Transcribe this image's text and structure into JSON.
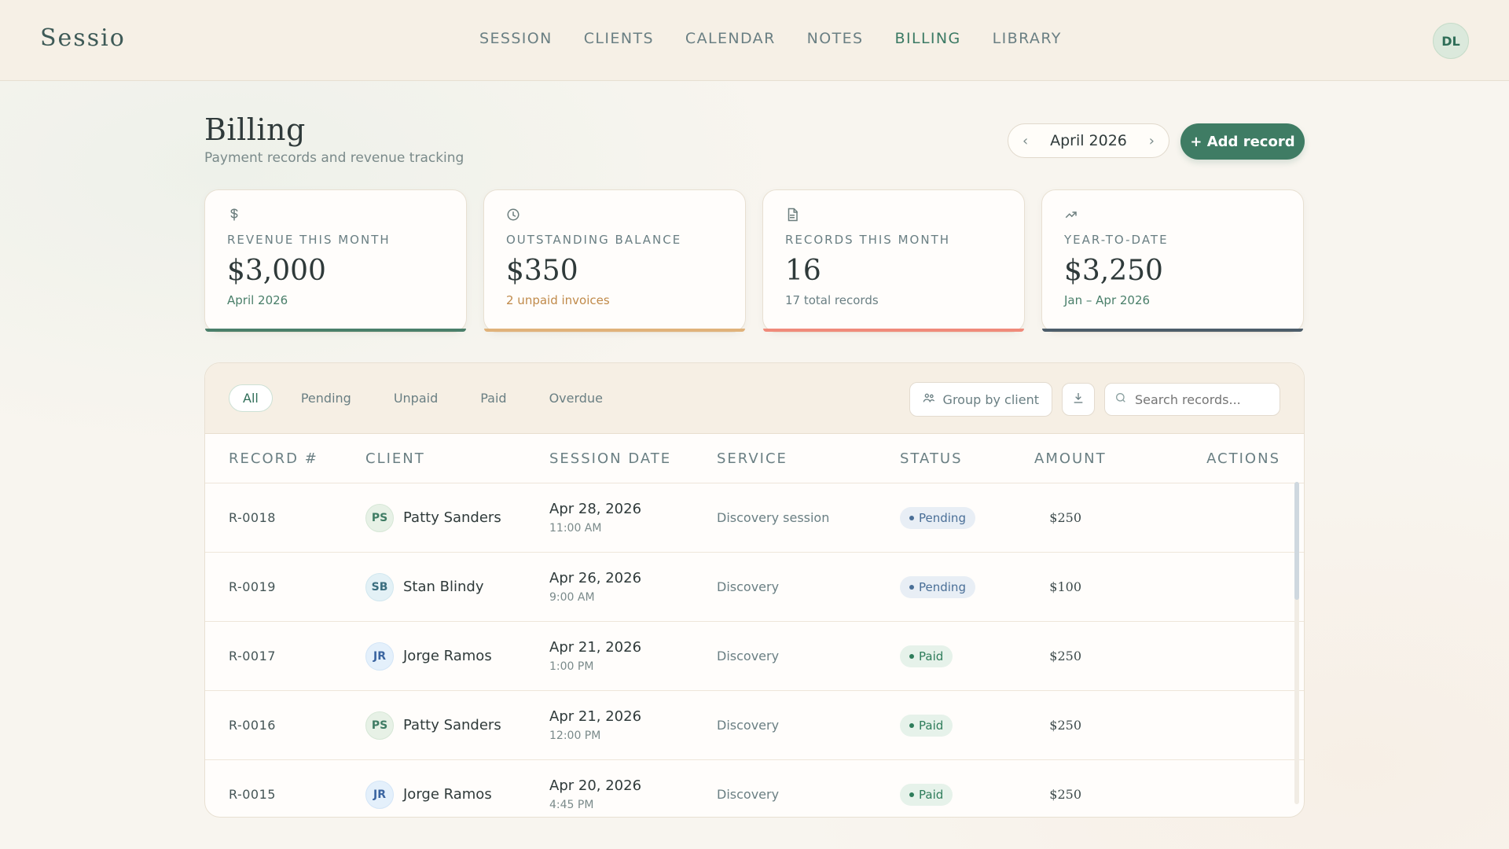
{
  "brand": "Sessio",
  "nav": {
    "items": [
      "SESSION",
      "CLIENTS",
      "CALENDAR",
      "NOTES",
      "BILLING",
      "LIBRARY"
    ],
    "active": "BILLING"
  },
  "user": {
    "initials": "DL"
  },
  "header": {
    "title": "Billing",
    "subtitle": "Payment records and revenue tracking",
    "month_label": "April 2026",
    "add_button": "+ Add record"
  },
  "stats": [
    {
      "kicker": "REVENUE THIS MONTH",
      "value": "$3,000",
      "sub": "April 2026",
      "icon": "dollar-icon",
      "sub_color": "#4a7f6a",
      "accent": "#4a7f6a"
    },
    {
      "kicker": "OUTSTANDING BALANCE",
      "value": "$350",
      "sub": "2 unpaid invoices",
      "icon": "clock-icon",
      "sub_color": "#c08a4a",
      "accent": "#e0b27a"
    },
    {
      "kicker": "RECORDS THIS MONTH",
      "value": "16",
      "sub": "17 total records",
      "icon": "document-icon",
      "sub_color": "#6a7f83",
      "accent": "#f08a7a"
    },
    {
      "kicker": "YEAR-TO-DATE",
      "value": "$3,250",
      "sub": "Jan – Apr 2026",
      "icon": "trend-icon",
      "sub_color": "#4a7f6a",
      "accent": "#4d5d6a"
    }
  ],
  "filters": [
    "All",
    "Pending",
    "Unpaid",
    "Paid",
    "Overdue"
  ],
  "toolbar": {
    "group_by": "Group by client",
    "search_placeholder": "Search records..."
  },
  "table": {
    "headers": [
      "RECORD #",
      "CLIENT",
      "SESSION DATE",
      "SERVICE",
      "STATUS",
      "AMOUNT",
      "ACTIONS"
    ],
    "rows": [
      {
        "record": "R-0018",
        "initials": "PS",
        "client": "Patty Sanders",
        "date": "Apr 28, 2026",
        "time": "11:00 AM",
        "service": "Discovery session",
        "status": "Pending",
        "amount": "$250"
      },
      {
        "record": "R-0019",
        "initials": "SB",
        "client": "Stan Blindy",
        "date": "Apr 26, 2026",
        "time": "9:00 AM",
        "service": "Discovery",
        "status": "Pending",
        "amount": "$100"
      },
      {
        "record": "R-0017",
        "initials": "JR",
        "client": "Jorge Ramos",
        "date": "Apr 21, 2026",
        "time": "1:00 PM",
        "service": "Discovery",
        "status": "Paid",
        "amount": "$250"
      },
      {
        "record": "R-0016",
        "initials": "PS",
        "client": "Patty Sanders",
        "date": "Apr 21, 2026",
        "time": "12:00 PM",
        "service": "Discovery",
        "status": "Paid",
        "amount": "$250"
      },
      {
        "record": "R-0015",
        "initials": "JR",
        "client": "Jorge Ramos",
        "date": "Apr 20, 2026",
        "time": "4:45 PM",
        "service": "Discovery",
        "status": "Paid",
        "amount": "$250"
      }
    ]
  },
  "colors": {
    "primary": "#3f7c64",
    "bg": "#f8f5ef"
  }
}
